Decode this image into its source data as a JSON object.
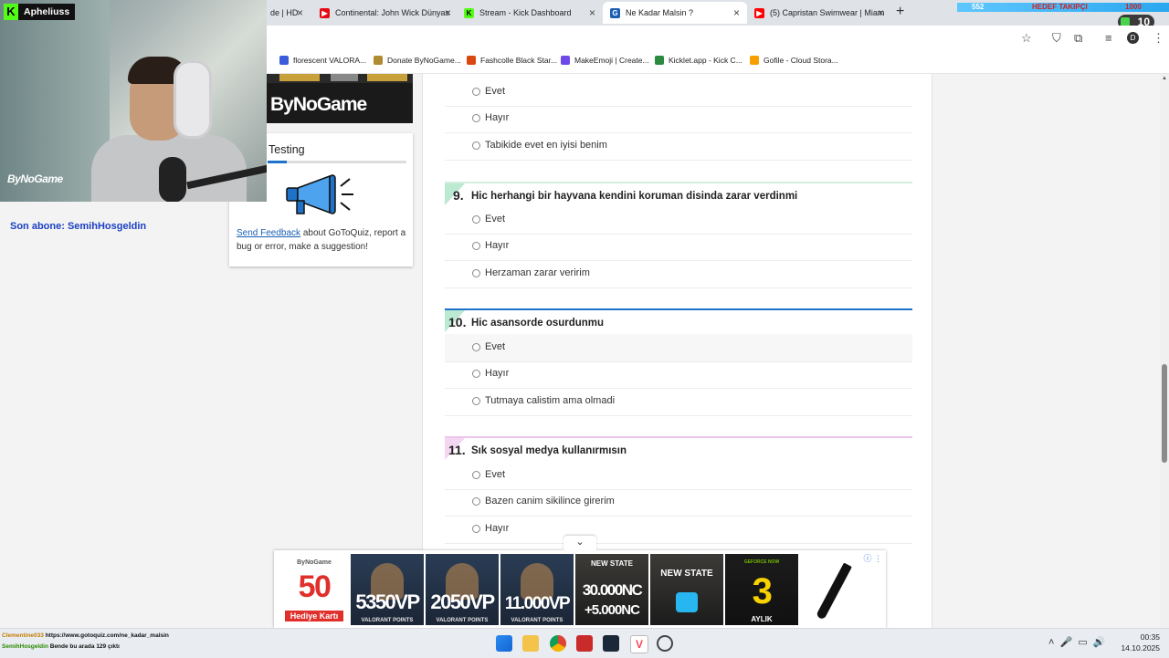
{
  "browser": {
    "tabs": [
      {
        "label": "de | HD",
        "favicon_color": "#1a73e8",
        "active": false
      },
      {
        "label": "Continental: John Wick Dünyas",
        "favicon_color": "#e50914",
        "active": false
      },
      {
        "label": "Stream - Kick Dashboard",
        "favicon_color": "#53fc18",
        "active": false
      },
      {
        "label": "Ne Kadar Malsin ?",
        "favicon_color": "#1a5fb4",
        "active": true
      },
      {
        "label": "(5) Capristan Swimwear | Miam",
        "favicon_color": "#ff0000",
        "active": false
      }
    ],
    "new_tab_icon": "plus-icon",
    "bookmarks": [
      {
        "label": "florescent VALORA...",
        "color": "#3b5bdb"
      },
      {
        "label": "Donate ByNoGame...",
        "color": "#b08a2e"
      },
      {
        "label": "Fashcolle Black Star...",
        "color": "#d9480f"
      },
      {
        "label": "MakeEmoji | Create...",
        "color": "#7048e8"
      },
      {
        "label": "Kicklet.app - Kick C...",
        "color": "#2b8a3e"
      },
      {
        "label": "Gofile - Cloud Stora...",
        "color": "#f59f00"
      }
    ],
    "profile_initial": "D"
  },
  "stream": {
    "streamer_name": "Apheliuss",
    "hud_left_value": "552",
    "hud_label": "HEDEF TAKIPÇI",
    "hud_right_value": "1000",
    "follower_count": "10",
    "cam_brand": "ByNoGame",
    "last_sub": "Son abone: SemihHosgeldin"
  },
  "sidebar": {
    "logo": "ByNoGame",
    "feedback": {
      "title": "Testing",
      "progress_fraction": 0.14,
      "link_text": "Send Feedback",
      "body_text": " about GoToQuiz, report a bug or error, make a suggestion!"
    }
  },
  "quiz": {
    "partial_options": [
      "Evet",
      "Hayır",
      "Tabikide evet en iyisi benim"
    ],
    "questions": [
      {
        "number": "9.",
        "text": "Hic herhangi bir hayvana kendini koruman disinda zarar verdinmi",
        "accent": "#cfeedd",
        "options": [
          "Evet",
          "Hayır",
          "Herzaman zarar veririm"
        ]
      },
      {
        "number": "10.",
        "text": "Hic asansorde osurdunmu",
        "accent": "#1e73c8",
        "options": [
          "Evet",
          "Hayır",
          "Tutmaya calistim ama olmadi"
        ]
      },
      {
        "number": "11.",
        "text": "Sık sosyal medya kullanırmısın",
        "accent": "#e6b3e6",
        "options": [
          "Evet",
          "Bazen canim sikilince girerim",
          "Hayır"
        ]
      }
    ]
  },
  "ad": {
    "toggle_icon": "chevron-down-icon",
    "info_icon": "info-icon",
    "cards": [
      {
        "top": "ByNoGame",
        "big": "50",
        "small": "Hediye Kartı"
      },
      {
        "top": "",
        "big": "5350VP",
        "small": "VALORANT POINTS"
      },
      {
        "top": "",
        "big": "2050VP",
        "small": "VALORANT POINTS"
      },
      {
        "top": "",
        "big": "11.000VP",
        "small": "VALORANT POINTS"
      },
      {
        "top": "NEW STATE",
        "big": "30.000NC",
        "small": "+5.000NC"
      },
      {
        "top": "NEW STATE",
        "big": "",
        "small": ""
      },
      {
        "top": "GEFORCE NOW",
        "big": "3",
        "small": "AYLIK"
      }
    ]
  },
  "taskbar": {
    "chat": [
      {
        "user": "Clementine033",
        "message": "https://www.gotoquiz.com/ne_kadar_malsin"
      },
      {
        "user": "SemihHosgeldin",
        "message": "Bende bu arada 129 çıktı"
      }
    ],
    "time": "00:35",
    "date": "14.10.2025"
  }
}
